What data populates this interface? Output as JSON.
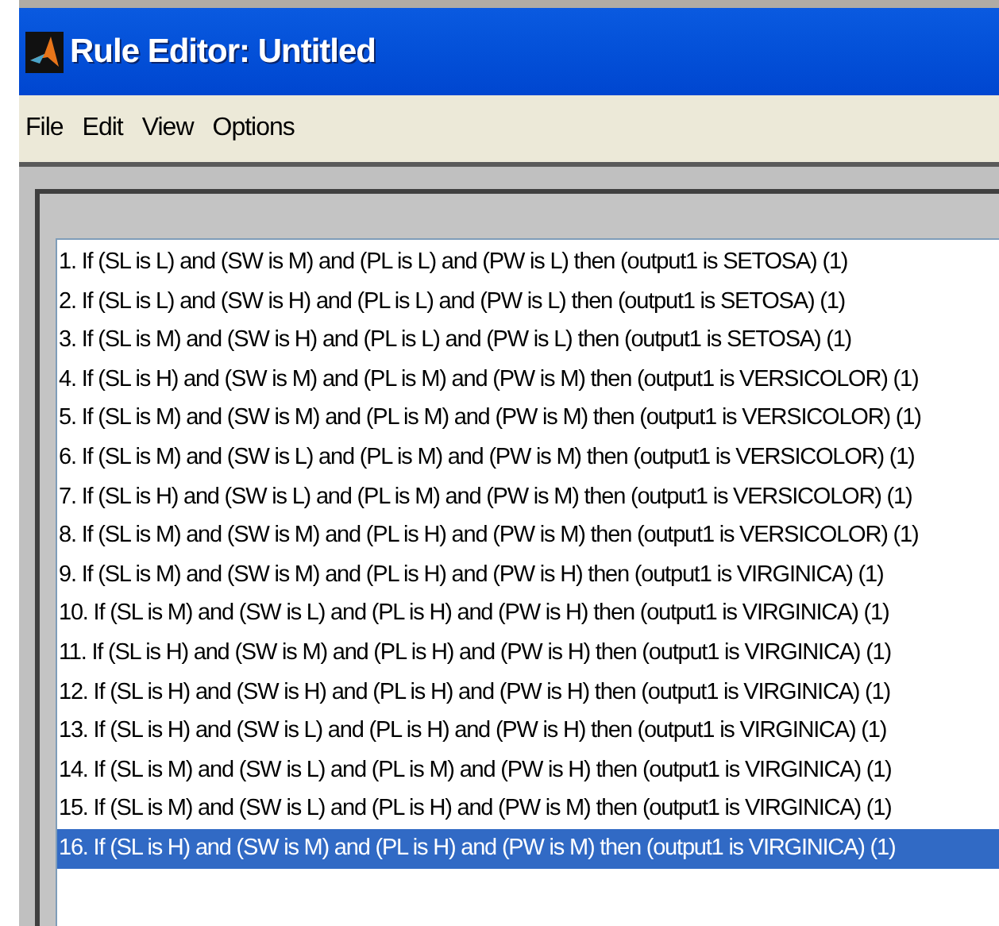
{
  "window": {
    "title": "Rule Editor: Untitled"
  },
  "menu": [
    "File",
    "Edit",
    "View",
    "Options"
  ],
  "rules": [
    {
      "text": "1. If (SL is L) and (SW is M) and (PL is L) and (PW is L) then (output1 is SETOSA) (1)",
      "selected": false
    },
    {
      "text": "2. If (SL is L) and (SW is H) and (PL is L) and (PW is L) then (output1 is SETOSA) (1)",
      "selected": false
    },
    {
      "text": "3. If (SL is M) and (SW is H) and (PL is L) and (PW is L) then (output1 is SETOSA) (1)",
      "selected": false
    },
    {
      "text": "4. If (SL is H) and (SW is M) and (PL is M) and (PW is M) then (output1 is VERSICOLOR) (1)",
      "selected": false
    },
    {
      "text": "5. If (SL is M) and (SW is M) and (PL is M) and (PW is M) then (output1 is VERSICOLOR) (1)",
      "selected": false
    },
    {
      "text": "6. If (SL is M) and (SW is L) and (PL is M) and (PW is M) then (output1 is VERSICOLOR) (1)",
      "selected": false
    },
    {
      "text": "7. If (SL is H) and (SW is L) and (PL is M) and (PW is M) then (output1 is VERSICOLOR) (1)",
      "selected": false
    },
    {
      "text": "8. If (SL is M) and (SW is M) and (PL is H) and (PW is M) then (output1 is VERSICOLOR) (1)",
      "selected": false
    },
    {
      "text": "9. If (SL is M) and (SW is M) and (PL is H) and (PW is H) then (output1 is VIRGINICA) (1)",
      "selected": false
    },
    {
      "text": "10. If (SL is M) and (SW is L) and (PL is H) and (PW is H) then (output1 is VIRGINICA) (1)",
      "selected": false
    },
    {
      "text": "11. If (SL is H) and (SW is M) and (PL is H) and (PW is H) then (output1 is VIRGINICA) (1)",
      "selected": false
    },
    {
      "text": "12. If (SL is H) and (SW is H) and (PL is H) and (PW is H) then (output1 is VIRGINICA) (1)",
      "selected": false
    },
    {
      "text": "13. If (SL is H) and (SW is L) and (PL is H) and (PW is H) then (output1 is VIRGINICA) (1)",
      "selected": false
    },
    {
      "text": "14. If (SL is M) and (SW is L) and (PL is M) and (PW is H) then (output1 is VIRGINICA) (1)",
      "selected": false
    },
    {
      "text": "15. If (SL is M) and (SW is L) and (PL is H) and (PW is M) then (output1 is VIRGINICA) (1)",
      "selected": false
    },
    {
      "text": "16. If (SL is H) and (SW is M) and (PL is H) and (PW is M) then (output1 is VIRGINICA) (1)",
      "selected": true
    }
  ]
}
